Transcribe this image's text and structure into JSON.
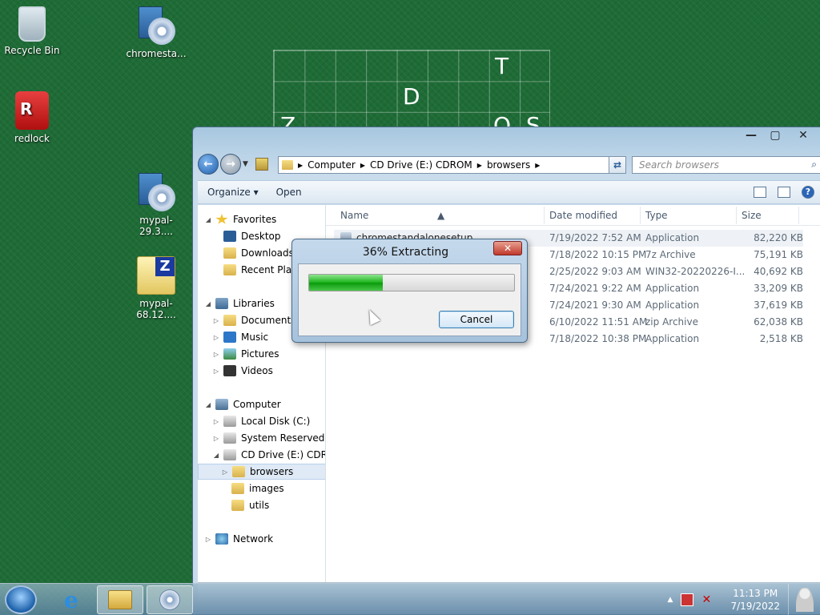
{
  "desktop": {
    "icons": [
      {
        "label": "Recycle Bin",
        "icon": "recycle-bin-icon"
      },
      {
        "label": "chromesta...",
        "icon": "setup-disc-icon"
      },
      {
        "label": "redlock",
        "icon": "redlock-icon"
      },
      {
        "label": "mypal-29.3....",
        "icon": "setup-disc-icon"
      },
      {
        "label": "mypal-68.12....",
        "icon": "zip-archive-icon"
      }
    ],
    "puzzle_letters": [
      "T",
      "D",
      "Z",
      "Q",
      "S"
    ]
  },
  "explorer": {
    "address": {
      "crumbs": [
        "Computer",
        "CD Drive (E:) CDROM",
        "browsers"
      ]
    },
    "search_placeholder": "Search browsers",
    "toolbar": {
      "organize": "Organize ▾",
      "open": "Open"
    },
    "nav": {
      "favorites": "Favorites",
      "desktop": "Desktop",
      "downloads": "Downloads",
      "recent": "Recent Places",
      "libraries": "Libraries",
      "documents": "Documents",
      "music": "Music",
      "pictures": "Pictures",
      "videos": "Videos",
      "computer": "Computer",
      "local_disk": "Local Disk (C:)",
      "system_reserved": "System Reserved (D:",
      "cd_drive": "CD Drive (E:) CDROM",
      "browsers": "browsers",
      "images": "images",
      "utils": "utils",
      "network": "Network"
    },
    "columns": {
      "name": "Name",
      "date": "Date modified",
      "type": "Type",
      "size": "Size"
    },
    "files": [
      {
        "name": "chromestandalonesetup",
        "date": "7/19/2022 7:52 AM",
        "type": "Application",
        "size": "82,220 KB"
      },
      {
        "name": "",
        "date": "7/18/2022 10:15 PM",
        "type": "7z Archive",
        "size": "75,191 KB"
      },
      {
        "name": "",
        "date": "2/25/2022 9:03 AM",
        "type": "WIN32-20220226-I...",
        "size": "40,692 KB"
      },
      {
        "name": "",
        "date": "7/24/2021 9:22 AM",
        "type": "Application",
        "size": "33,209 KB"
      },
      {
        "name": "",
        "date": "7/24/2021 9:30 AM",
        "type": "Application",
        "size": "37,619 KB"
      },
      {
        "name": "",
        "date": "6/10/2022 11:51 AM",
        "type": "zip Archive",
        "size": "62,038 KB"
      },
      {
        "name": "",
        "date": "7/18/2022 10:38 PM",
        "type": "Application",
        "size": "2,518 KB"
      }
    ]
  },
  "dialog": {
    "title": "36% Extracting",
    "progress_percent": 36,
    "cancel": "Cancel",
    "close": "✕"
  },
  "taskbar": {
    "time": "11:13 PM",
    "date": "7/19/2022"
  }
}
